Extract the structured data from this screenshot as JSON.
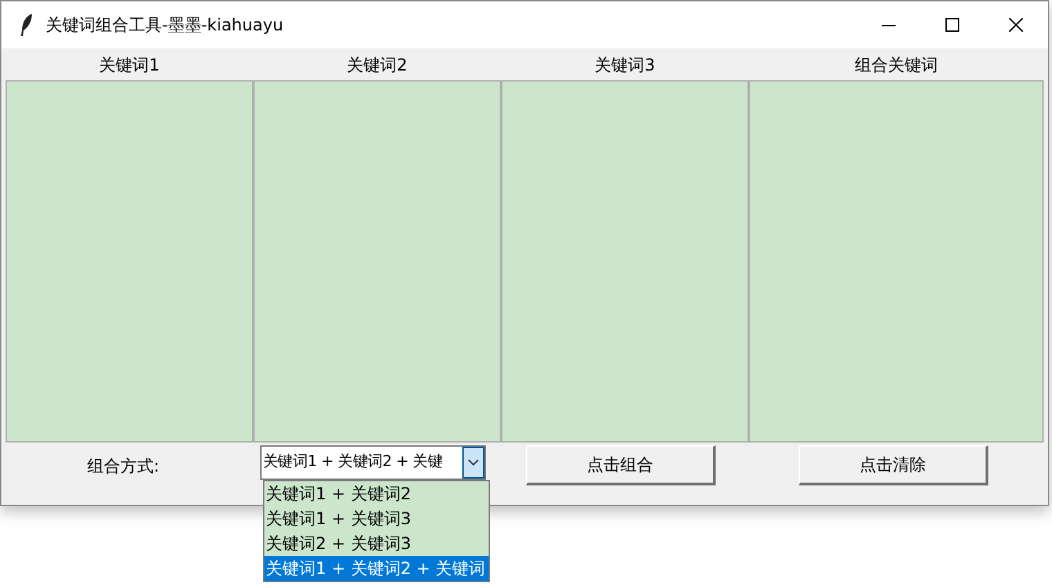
{
  "window": {
    "title": "关键词组合工具-墨墨-kiahuayu"
  },
  "columns": [
    {
      "header": "关键词1"
    },
    {
      "header": "关键词2"
    },
    {
      "header": "关键词3"
    },
    {
      "header": "组合关键词"
    }
  ],
  "combine_label": "组合方式:",
  "combobox": {
    "value": "关键词1 + 关键词2 + 关键",
    "expanded": true,
    "options": [
      {
        "label": "关键词1 + 关键词2",
        "selected": false
      },
      {
        "label": "关键词1 + 关键词3",
        "selected": false
      },
      {
        "label": "关键词2 + 关键词3",
        "selected": false
      },
      {
        "label": "关键词1 + 关键词2 + 关键词",
        "selected": true
      }
    ]
  },
  "buttons": [
    "点击组合",
    "点击清除"
  ]
}
